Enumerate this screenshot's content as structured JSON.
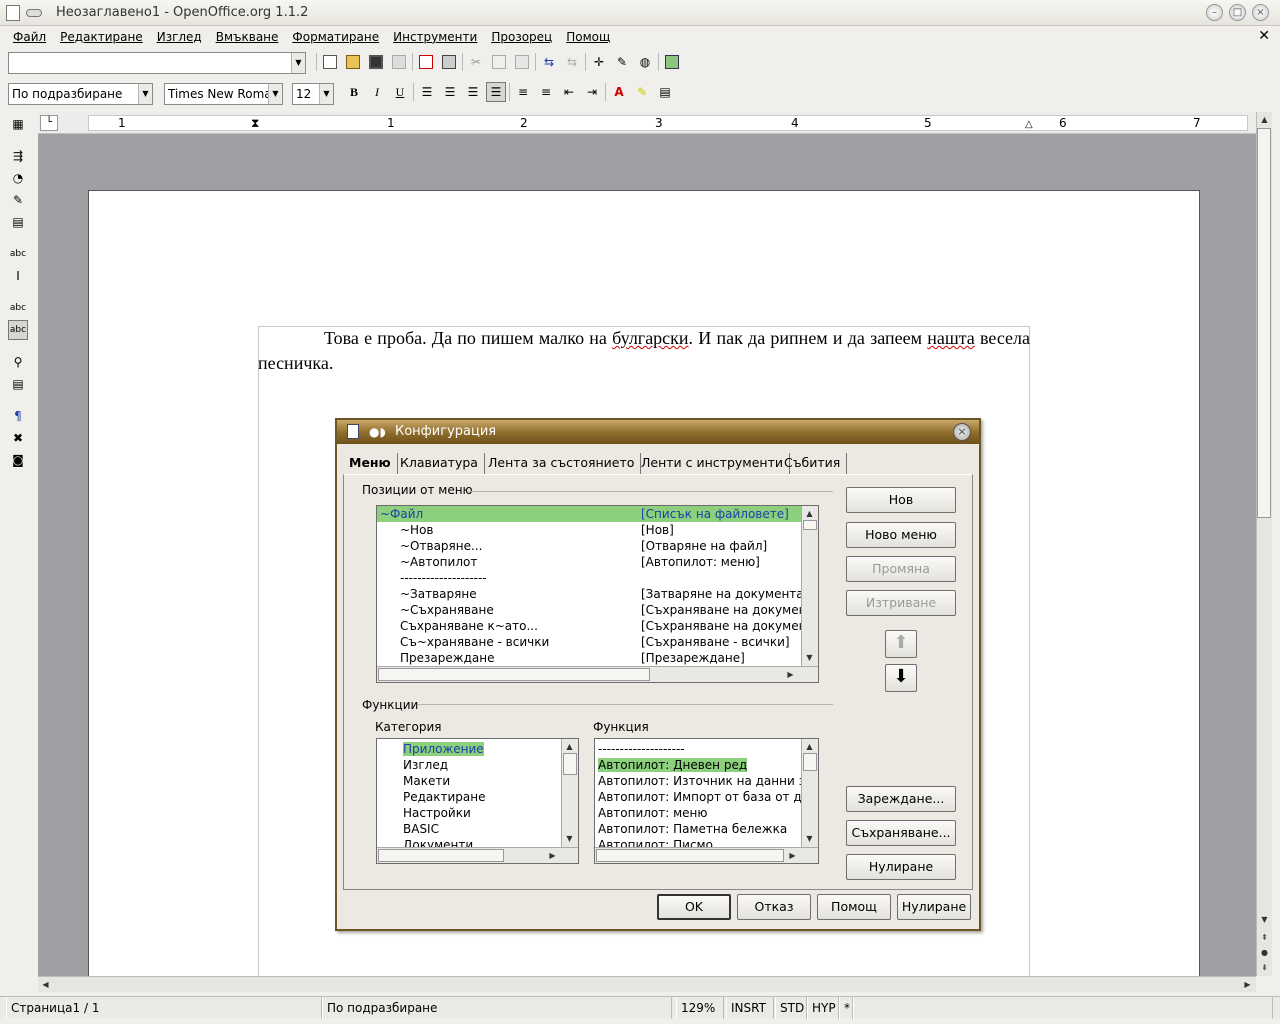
{
  "window": {
    "title": "Неозаглавено1 - OpenOffice.org 1.1.2"
  },
  "menubar": {
    "items": [
      "Файл",
      "Редактиране",
      "Изглед",
      "Вмъкване",
      "Форматиране",
      "Инструменти",
      "Прозорец",
      "Помощ"
    ]
  },
  "toolbar": {
    "url_value": "",
    "style_value": "По подразбиране",
    "font_value": "Times New Roma",
    "size_value": "12"
  },
  "ruler": {
    "numbers": [
      "1",
      "1",
      "2",
      "3",
      "4",
      "5",
      "6",
      "7"
    ]
  },
  "document": {
    "text_before": "Това е проба. Да по пишем малко на ",
    "word1": "булгарски",
    "text_mid": ". И пак да рипнем и да запеем ",
    "word2": "нашта",
    "text_after": " весела песничка."
  },
  "dialog": {
    "title": "Конфигурация",
    "tabs": [
      "Меню",
      "Клавиатура",
      "Лента за състоянието",
      "Ленти с инструменти",
      "Събития"
    ],
    "menu_entries_label": "Позиции от меню",
    "menu_entries": [
      {
        "name": "~Файл",
        "cmd": "[Списък на файловете]",
        "selected": true
      },
      {
        "name": "~Нов",
        "cmd": "[Нов]"
      },
      {
        "name": "~Отваряне...",
        "cmd": "[Отваряне на файл]"
      },
      {
        "name": "~Автопилот",
        "cmd": "[Автопилот: меню]"
      },
      {
        "name": "--------------------",
        "cmd": ""
      },
      {
        "name": "~Затваряне",
        "cmd": "[Затваряне на документа]"
      },
      {
        "name": "~Съхраняване",
        "cmd": "[Съхраняване на документ]"
      },
      {
        "name": "Съхраняване к~ато...",
        "cmd": "[Съхраняване на документ"
      },
      {
        "name": "Съ~храняване - всички",
        "cmd": "[Съхраняване - всички]"
      },
      {
        "name": "Презареждане",
        "cmd": "[Презареждане]"
      }
    ],
    "functions_label": "Функции",
    "category_label": "Категория",
    "function_label": "Функция",
    "categories": [
      "Приложение",
      "Изглед",
      "Макети",
      "Редактиране",
      "Настройки",
      "BASIC",
      "Документи"
    ],
    "functions": [
      "--------------------",
      "Автопилот: Дневен ред",
      "Автопилот: Източник на данни за а",
      "Автопилот: Импорт от база от данн",
      "Автопилот: меню",
      "Автопилот: Паметна бележка",
      "Автопилот: Писмо"
    ],
    "side_buttons": {
      "new": "Нов",
      "new_menu": "Ново меню",
      "modify": "Промяна",
      "delete": "Изтриване"
    },
    "file_buttons": {
      "load": "Зареждане...",
      "save": "Съхраняване...",
      "reset": "Нулиране"
    },
    "bottom_buttons": {
      "ok": "OK",
      "cancel": "Отказ",
      "help": "Помощ",
      "reset": "Нулиране"
    }
  },
  "statusbar": {
    "page": "Страница1 / 1",
    "style": "По подразбиране",
    "zoom": "129%",
    "insert": "INSRT",
    "selection": "STD",
    "hyperlink": "HYP",
    "modified": "*"
  }
}
